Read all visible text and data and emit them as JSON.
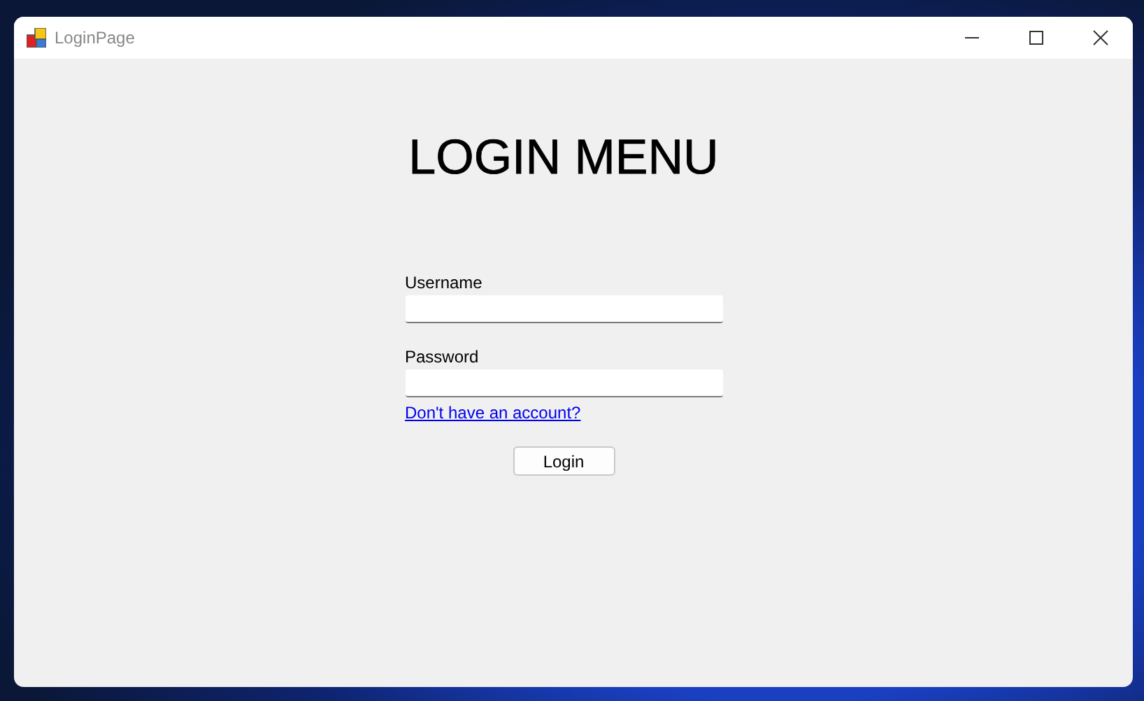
{
  "window": {
    "title": "LoginPage"
  },
  "heading": "LOGIN MENU",
  "fields": [
    {
      "label": "Username"
    },
    {
      "label": "Password"
    }
  ],
  "signup_link": "Don't have an account?",
  "login_button": "Login"
}
